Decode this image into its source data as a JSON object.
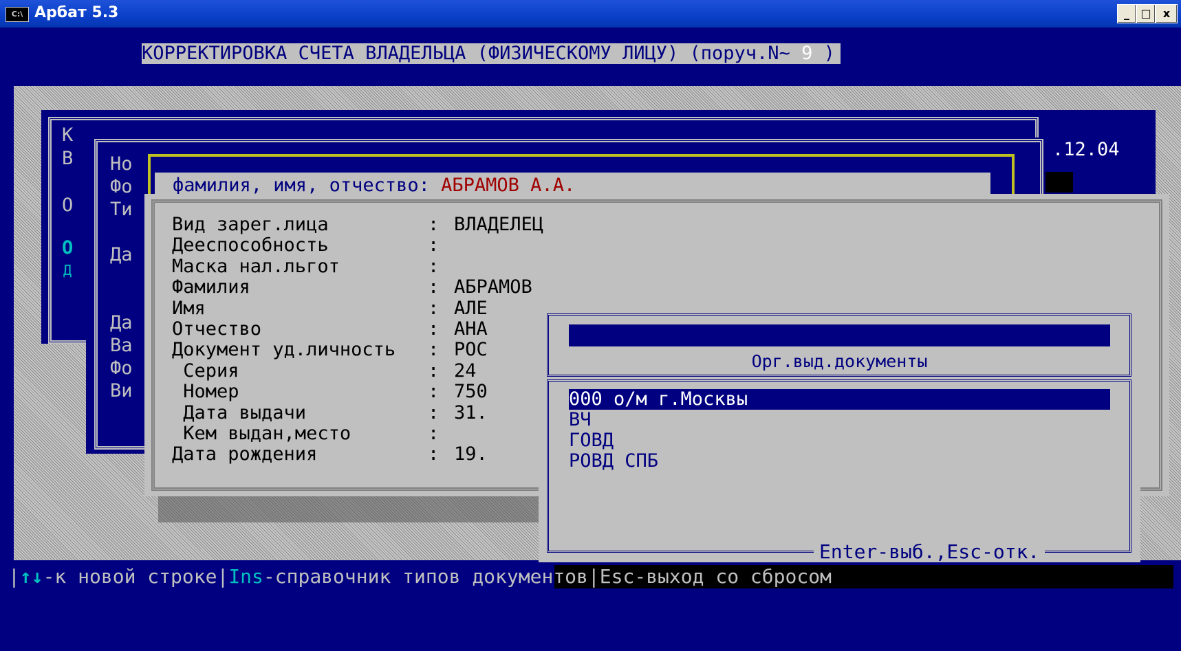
{
  "window": {
    "title": "Арбат 5.3",
    "icon_label": "C:\\",
    "minimize_label": "_",
    "maximize_label": "□",
    "close_label": "x"
  },
  "header": {
    "title": "КОРРЕКТИРОВКА СЧЕТА ВЛАДЕЛЬЦА (ФИЗИЧЕСКОМУ ЛИЦУ) (поруч.N~",
    "order_number": " 9 ",
    "title_end": ")"
  },
  "background_window": {
    "letters": [
      "К",
      "В",
      "О",
      "О",
      "Д"
    ],
    "date_fragment": ".12.04"
  },
  "middle_window": {
    "labels": [
      "Но",
      "Фо",
      "Ти",
      "Да",
      "Да",
      "Ва",
      "Фо",
      "Ви"
    ]
  },
  "name_bar": {
    "label": "фамилия, имя, отчество:",
    "value": "АБРАМОВ А.А."
  },
  "form": {
    "rows": [
      {
        "label": "Вид зарег.лица        ",
        "sep": ":",
        "value": "ВЛАДЕЛЕЦ"
      },
      {
        "label": "Дееспособность        ",
        "sep": ":",
        "value": ""
      },
      {
        "label": "Маска нал.льгот       ",
        "sep": ":",
        "value": ""
      },
      {
        "label": "Фамилия               ",
        "sep": ":",
        "value": "АБРАМОВ"
      },
      {
        "label": "Имя                   ",
        "sep": ":",
        "value": "АЛЕ"
      },
      {
        "label": "Отчество              ",
        "sep": ":",
        "value": "АНА"
      },
      {
        "label": "Документ уд.личность",
        "sep": ":",
        "value": "РОС"
      },
      {
        "label": " Серия                ",
        "sep": ":",
        "value": "24"
      },
      {
        "label": " Номер                ",
        "sep": ":",
        "value": "750"
      },
      {
        "label": " Дата выдачи          ",
        "sep": ":",
        "value": "31."
      },
      {
        "label": " Кем выдан,место      ",
        "sep": ":",
        "value": ""
      },
      {
        "label": "Дата рождения         ",
        "sep": ":",
        "value": "19."
      }
    ]
  },
  "lookup_popup": {
    "title": "Орг.выд.документы",
    "search_value": "",
    "items": [
      "000 о/м г.Москвы",
      "ВЧ",
      "ГОВД",
      "РОВД СПБ"
    ],
    "selected_index": 0,
    "footer_hint": "Enter-выб.,Esc-отк."
  },
  "status_bar": {
    "arrows": "↑↓",
    "new_row": "-к новой строке",
    "ins_key": "Ins",
    "ins_text": "-справочник типов документов",
    "esc_text": "Esc-выход со сбросом"
  },
  "colors": {
    "console_blue": "#000080",
    "dialog_gray": "#c0c0c0",
    "highlight_cyan": "#00c0c0",
    "error_red": "#a00000"
  }
}
